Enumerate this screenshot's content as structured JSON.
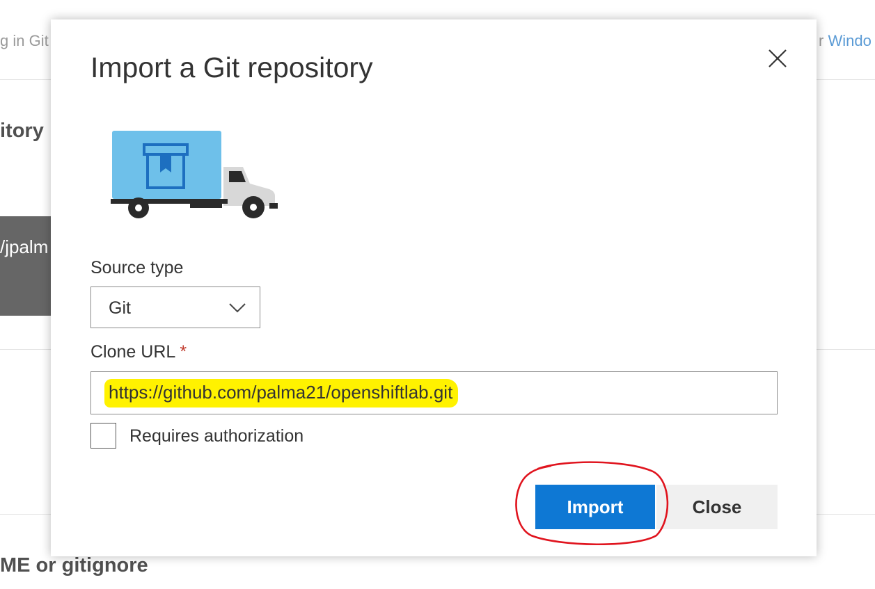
{
  "background": {
    "top_left_fragment": "g in Git",
    "top_right_prefix": "r ",
    "top_right_link": "Windo",
    "heading_fragment": "itory",
    "panel_fragment": "/jpalm",
    "bottom_fragment": "ME or gitignore"
  },
  "dialog": {
    "title": "Import a Git repository",
    "close_icon": "close-icon",
    "illustration_icon": "truck-icon",
    "source_type": {
      "label": "Source type",
      "selected": "Git"
    },
    "clone_url": {
      "label": "Clone URL",
      "required_marker": "*",
      "value": "https://github.com/palma21/openshiftlab.git"
    },
    "auth_checkbox": {
      "label": "Requires authorization",
      "checked": false
    },
    "buttons": {
      "import_label": "Import",
      "close_label": "Close"
    }
  },
  "colors": {
    "primary_button": "#0e78d4",
    "url_highlight": "#fff200",
    "annotation_circle": "#e0141e",
    "truck_cargo": "#6ec0ea",
    "truck_cargo_icon": "#1d6fc0"
  }
}
